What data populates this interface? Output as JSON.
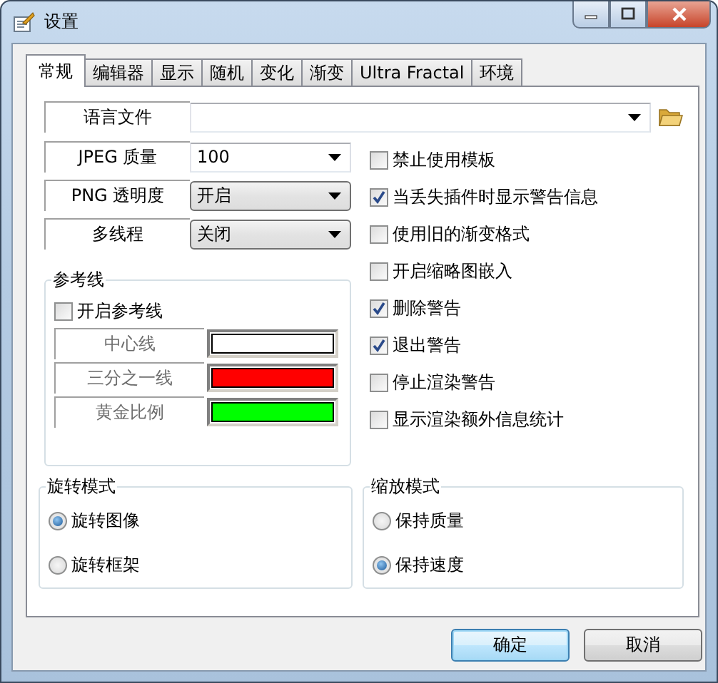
{
  "window": {
    "title": "设置"
  },
  "tabs": [
    {
      "label": "常规",
      "selected": true
    },
    {
      "label": "编辑器",
      "selected": false
    },
    {
      "label": "显示",
      "selected": false
    },
    {
      "label": "随机",
      "selected": false
    },
    {
      "label": "变化",
      "selected": false
    },
    {
      "label": "渐变",
      "selected": false
    },
    {
      "label": "Ultra Fractal",
      "selected": false
    },
    {
      "label": "环境",
      "selected": false
    }
  ],
  "language_file": {
    "label": "语言文件"
  },
  "combos": [
    {
      "label": "JPEG 质量",
      "value": "100",
      "kind": "editable"
    },
    {
      "label": "PNG 透明度",
      "value": "开启",
      "kind": "list"
    },
    {
      "label": "多线程",
      "value": "关闭",
      "kind": "list"
    }
  ],
  "options": [
    {
      "label": "禁止使用模板",
      "checked": false
    },
    {
      "label": "当丢失插件时显示警告信息",
      "checked": true
    },
    {
      "label": "使用旧的渐变格式",
      "checked": false
    },
    {
      "label": "开启缩略图嵌入",
      "checked": false
    },
    {
      "label": "删除警告",
      "checked": true
    },
    {
      "label": "退出警告",
      "checked": true
    },
    {
      "label": "停止渲染警告",
      "checked": false
    },
    {
      "label": "显示渲染额外信息统计",
      "checked": false
    }
  ],
  "guides": {
    "title": "参考线",
    "toggle": {
      "label": "开启参考线",
      "checked": false
    },
    "lines": [
      {
        "label": "中心线",
        "color": "#ffffff",
        "disabled": true
      },
      {
        "label": "三分之一线",
        "color": "#ff0000",
        "disabled": true
      },
      {
        "label": "黄金比例",
        "color": "#00ff00",
        "disabled": true
      }
    ]
  },
  "rotation_mode": {
    "title": "旋转模式",
    "options": [
      {
        "label": "旋转图像",
        "selected": true
      },
      {
        "label": "旋转框架",
        "selected": false
      }
    ]
  },
  "scale_mode": {
    "title": "缩放模式",
    "options": [
      {
        "label": "保持质量",
        "selected": false
      },
      {
        "label": "保持速度",
        "selected": true
      }
    ]
  },
  "buttons": [
    {
      "label": "确定",
      "default": true
    },
    {
      "label": "取消",
      "default": false
    }
  ]
}
